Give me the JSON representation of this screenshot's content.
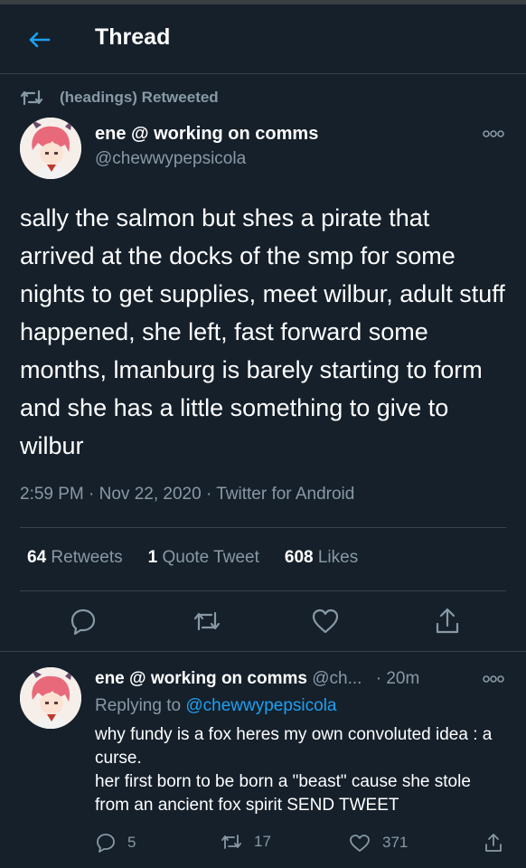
{
  "header": {
    "title": "Thread"
  },
  "retweet_banner": {
    "text": "(headings) Retweeted"
  },
  "tweet": {
    "name": "ene @ working on comms",
    "handle": "@chewwypepsicola",
    "text": "sally the salmon but shes a pirate that arrived at the docks of the smp for some nights to get supplies, meet wilbur, adult stuff happened, she left, fast forward some months, lmanburg is barely starting to form and she has a little something to give to wilbur",
    "meta": "2:59 PM · Nov 22, 2020 · Twitter for Android",
    "stats": {
      "retweets_count": "64",
      "retweets_label": "Retweets",
      "quotes_count": "1",
      "quotes_label": "Quote Tweet",
      "likes_count": "608",
      "likes_label": "Likes"
    },
    "actions": [
      "reply-icon",
      "retweet-icon",
      "like-icon",
      "share-icon"
    ]
  },
  "reply": {
    "name": "ene @ working on comms",
    "handle": "@ch...",
    "time": "· 20m",
    "replying_prefix": "Replying to",
    "replying_to": "@chewwypepsicola",
    "text": "why fundy is a fox heres my own convoluted idea : a curse.\nher first born to be born a \"beast\" cause she stole from an ancient fox spirit SEND TWEET",
    "reply_count": "5",
    "retweet_count": "17",
    "like_count": "371"
  },
  "colors": {
    "background": "#15202b",
    "accent": "#1da1f2",
    "muted": "#8899a6",
    "divider": "#38444d"
  }
}
